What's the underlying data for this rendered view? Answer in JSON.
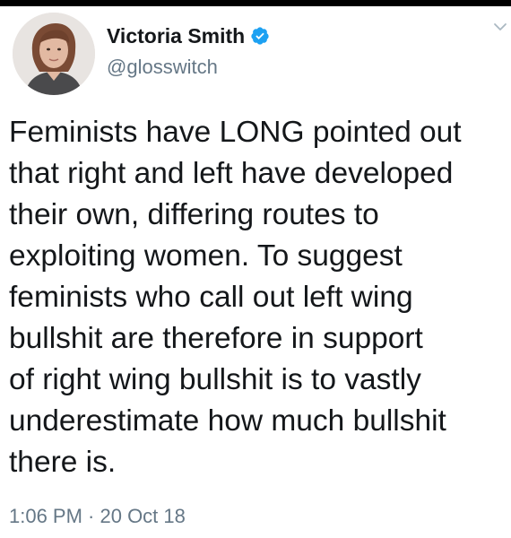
{
  "tweet": {
    "author": {
      "display_name": "Victoria Smith",
      "username": "@glosswitch",
      "verified": true,
      "avatar_icon": "avatar-photo"
    },
    "text": "Feminists have LONG pointed out\nthat right and left have developed\ntheir own, differing routes to\nexploiting women. To suggest\nfeminists who call out left wing\nbullshit are therefore in support\nof right wing bullshit is to vastly\nunderestimate how much bullshit\nthere is.",
    "timestamp": "1:06 PM · 20 Oct 18",
    "menu_icon": "chevron-down-icon"
  },
  "colors": {
    "text": "#14171a",
    "secondary_text": "#657786",
    "verified_blue": "#1da1f2",
    "top_bar": "#000000",
    "background": "#ffffff"
  }
}
